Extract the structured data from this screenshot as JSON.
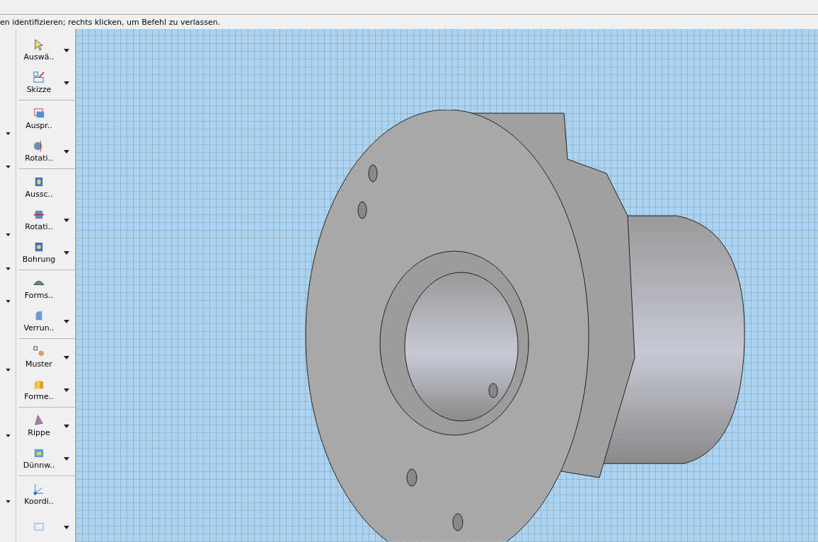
{
  "status_prompt": "en identifizieren; rechts klicken, um Befehl zu verlassen.",
  "toolbar": {
    "groups": [
      {
        "items": [
          {
            "label": "Auswä..",
            "has_menu": true
          },
          {
            "label": "Skizze",
            "has_menu": true
          }
        ]
      },
      {
        "items": [
          {
            "label": "Auspr..",
            "has_menu": false
          },
          {
            "label": "Rotati..",
            "has_menu": true
          }
        ]
      },
      {
        "items": [
          {
            "label": "Aussc..",
            "has_menu": false
          },
          {
            "label": "Rotati..",
            "has_menu": true
          },
          {
            "label": "Bohrung",
            "has_menu": true
          }
        ]
      },
      {
        "items": [
          {
            "label": "Forms..",
            "has_menu": false
          },
          {
            "label": "Verrun..",
            "has_menu": true
          }
        ]
      },
      {
        "items": [
          {
            "label": "Muster",
            "has_menu": true
          },
          {
            "label": "Forme..",
            "has_menu": true
          }
        ]
      },
      {
        "items": [
          {
            "label": "Rippe",
            "has_menu": true
          },
          {
            "label": "Dünnw..",
            "has_menu": true
          }
        ]
      },
      {
        "items": [
          {
            "label": "Koordi..",
            "has_menu": false
          },
          {
            "has_menu": true
          }
        ]
      }
    ]
  }
}
